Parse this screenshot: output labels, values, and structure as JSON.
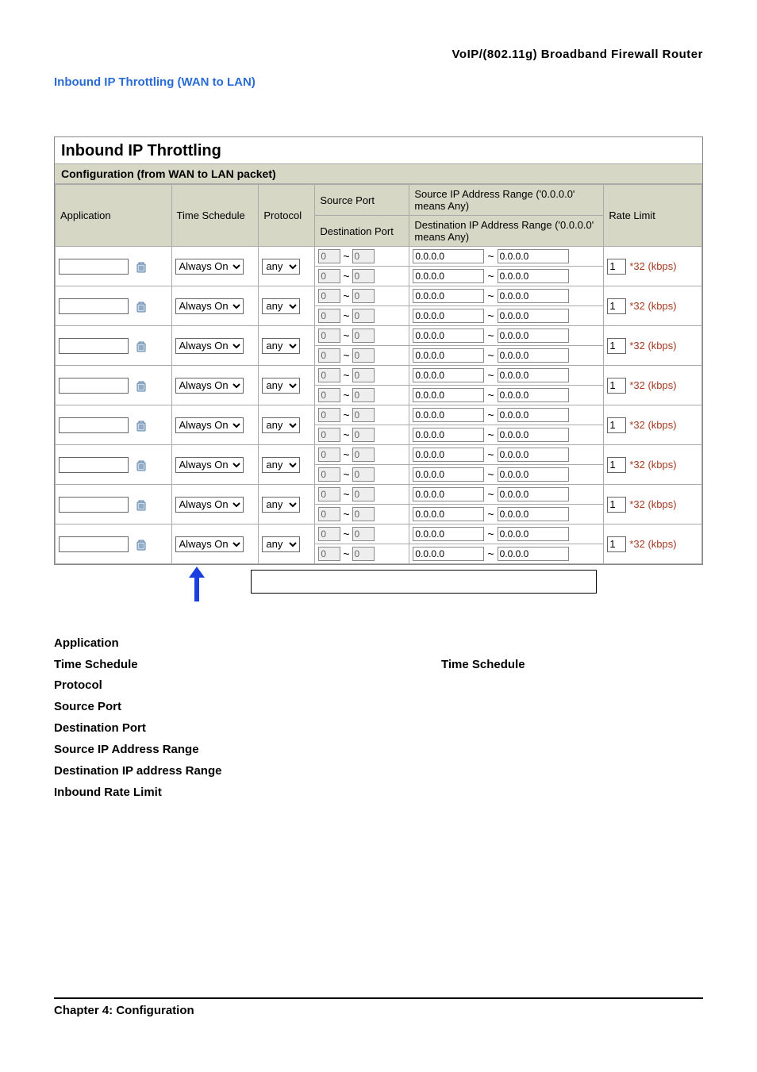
{
  "header": {
    "doc_title": "VoIP/(802.11g)  Broadband  Firewall  Router"
  },
  "section_link": "Inbound IP Throttling (WAN to LAN)",
  "ui": {
    "panel_title": "Inbound IP Throttling",
    "panel_sub": "Configuration (from WAN to LAN packet)",
    "cols": {
      "app": "Application",
      "time": "Time Schedule",
      "proto": "Protocol",
      "sport": "Source Port",
      "dport": "Destination Port",
      "sip": "Source IP Address Range ('0.0.0.0' means Any)",
      "dip": "Destination IP Address Range ('0.0.0.0' means Any)",
      "rate": "Rate Limit"
    },
    "row": {
      "time_sel": "Always On",
      "proto_sel": "any",
      "port_from": "0",
      "port_to": "0",
      "ip_from": "0.0.0.0",
      "ip_to": "0.0.0.0",
      "rate_val": "1",
      "rate_unit": "*32 (kbps)"
    },
    "row_count": 8
  },
  "defs": {
    "app": "Application",
    "time": "Time Schedule",
    "time_right": "Time Schedule",
    "proto": "Protocol",
    "sport": "Source Port",
    "dport": "Destination Port",
    "sip": "Source IP Address Range",
    "dip": "Destination IP address Range",
    "rate": "Inbound Rate Limit"
  },
  "footer": "Chapter 4: Configuration"
}
